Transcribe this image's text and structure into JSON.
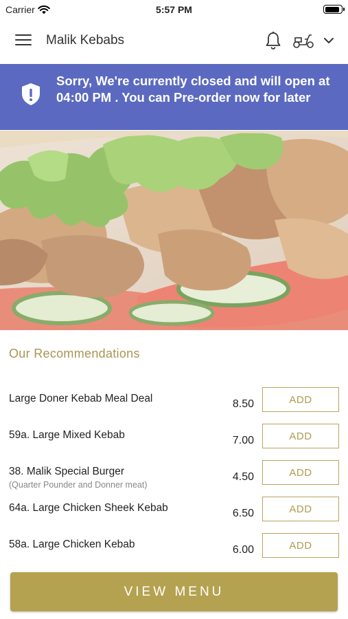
{
  "status": {
    "carrier": "Carrier",
    "time": "5:57 PM",
    "battery_level": 0.9
  },
  "header": {
    "title": "Malik Kebabs",
    "icons": [
      "menu-icon",
      "bell-icon",
      "scooter-icon",
      "chevron-down-icon"
    ]
  },
  "banner": {
    "message": "Sorry, We're currently closed and will open at 04:00 PM . You can Pre-order now for later",
    "background": "#5b6ac0"
  },
  "recommendations": {
    "title": "Our Recommendations",
    "items": [
      {
        "name": "Large Doner Kebab Meal Deal",
        "subtitle": "",
        "price": "8.50",
        "add_label": "ADD"
      },
      {
        "name": "59a. Large Mixed Kebab",
        "subtitle": "",
        "price": "7.00",
        "add_label": "ADD"
      },
      {
        "name": "38. Malik Special Burger",
        "subtitle": "(Quarter Pounder and Donner meat)",
        "price": "4.50",
        "add_label": "ADD"
      },
      {
        "name": "64a. Large Chicken Sheek Kebab",
        "subtitle": "",
        "price": "6.50",
        "add_label": "ADD"
      },
      {
        "name": "58a. Large Chicken Kebab",
        "subtitle": "",
        "price": "6.00",
        "add_label": "ADD"
      }
    ]
  },
  "view_menu_label": "VIEW MENU",
  "colors": {
    "accent": "#b5a250",
    "banner": "#5b6ac0"
  }
}
